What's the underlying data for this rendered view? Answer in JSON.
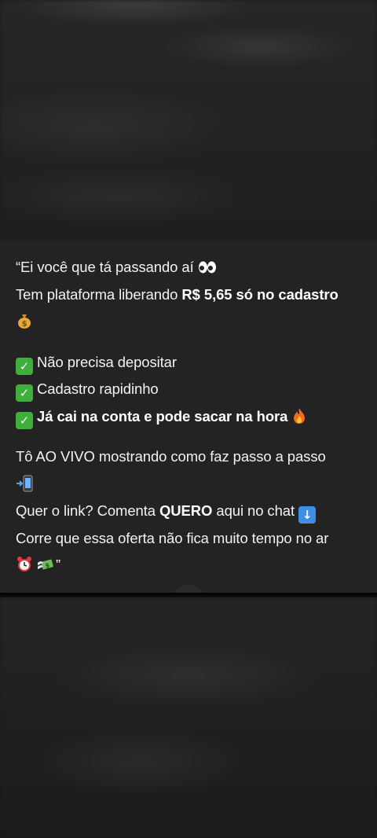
{
  "caption": {
    "line1": "“Ei você que tá passando aí",
    "line2_prefix": "Tem plataforma liberando ",
    "line2_bold": "R$ 5,65 só no cadastro",
    "check1": "Não precisa depositar",
    "check2": "Cadastro rapidinho",
    "check3_bold": "Já cai na conta e pode sacar na hora",
    "line_live": "Tô AO VIVO mostrando como faz passo a passo",
    "link_prefix": "Quer o link? Comenta ",
    "link_bold": "QUERO",
    "link_suffix": " aqui no chat",
    "line_last": "Corre que essa oferta não fica muito tempo no ar",
    "closing_quote": "”"
  },
  "icons": {
    "eyes": "eyes-icon",
    "money_bag": "money-bag-icon",
    "check": "check-mark-button-icon",
    "fire": "fire-icon",
    "phone": "mobile-phone-arrow-icon",
    "down_arrow": "down-arrow-icon",
    "alarm": "alarm-clock-icon",
    "cash": "money-with-wings-icon"
  },
  "colors": {
    "panel": "#232323",
    "background": "#1b1b1b",
    "check_green": "#3fae3a",
    "arrow_blue": "#3f8ee6"
  }
}
